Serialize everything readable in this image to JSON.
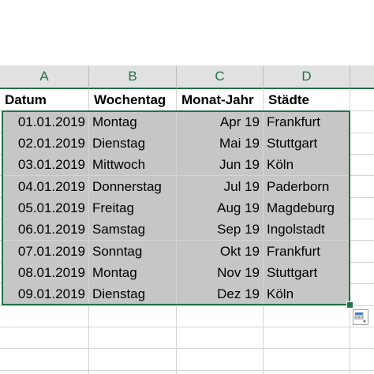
{
  "columns": {
    "a": "A",
    "b": "B",
    "c": "C",
    "d": "D"
  },
  "headers": {
    "datum": "Datum",
    "wochentag": "Wochentag",
    "monat_jahr": "Monat-Jahr",
    "staedte": "Städte"
  },
  "rows": [
    {
      "datum": "01.01.2019",
      "wochentag": "Montag",
      "monat": "Apr 19",
      "stadt": "Frankfurt"
    },
    {
      "datum": "02.01.2019",
      "wochentag": "Dienstag",
      "monat": "Mai 19",
      "stadt": "Stuttgart"
    },
    {
      "datum": "03.01.2019",
      "wochentag": "Mittwoch",
      "monat": "Jun 19",
      "stadt": "Köln"
    },
    {
      "datum": "04.01.2019",
      "wochentag": "Donnerstag",
      "monat": "Jul 19",
      "stadt": "Paderborn"
    },
    {
      "datum": "05.01.2019",
      "wochentag": "Freitag",
      "monat": "Aug 19",
      "stadt": "Magdeburg"
    },
    {
      "datum": "06.01.2019",
      "wochentag": "Samstag",
      "monat": "Sep 19",
      "stadt": "Ingolstadt"
    },
    {
      "datum": "07.01.2019",
      "wochentag": "Sonntag",
      "monat": "Okt 19",
      "stadt": "Frankfurt"
    },
    {
      "datum": "08.01.2019",
      "wochentag": "Montag",
      "monat": "Nov 19",
      "stadt": "Stuttgart"
    },
    {
      "datum": "09.01.2019",
      "wochentag": "Dienstag",
      "monat": "Dez 19",
      "stadt": "Köln"
    }
  ],
  "icons": {
    "quick_analysis": "quick-analysis-icon"
  },
  "colors": {
    "accent": "#217346",
    "selection_fill": "#c6c6c6",
    "header_fill": "#e1e1e1"
  }
}
